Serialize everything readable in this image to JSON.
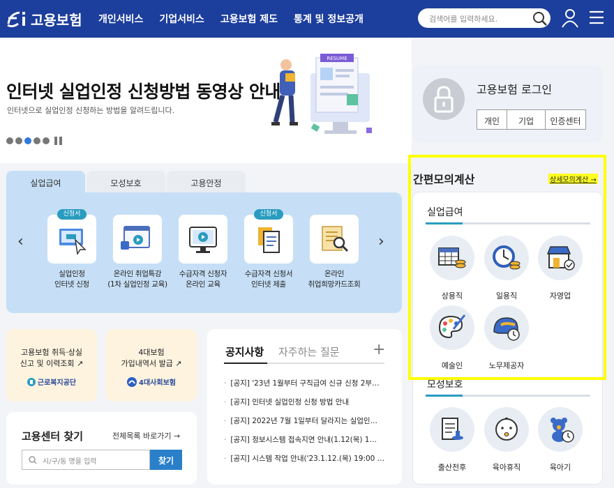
{
  "header": {
    "logo": "고용보험",
    "nav": [
      "개인서비스",
      "기업서비스",
      "고용보험 제도",
      "통계 및 정보공개"
    ],
    "search_placeholder": "검색어를 입력하세요."
  },
  "banner": {
    "title": "인터넷 실업인정 신청방법 동영상 안내",
    "subtitle": "인터넷으로 실업인정 신청하는 방법을 알려드립니다.",
    "slide_count": 5,
    "active_slide": 3,
    "illustration_text": "RESUME"
  },
  "login": {
    "title": "고용보험 로그인",
    "buttons": [
      "개인",
      "기업",
      "인증센터"
    ]
  },
  "tabs": [
    {
      "label": "실업급여"
    },
    {
      "label": "모성보호"
    },
    {
      "label": "고용안정"
    }
  ],
  "services": [
    {
      "badge": "신청서",
      "line1": "실업인정",
      "line2": "인터넷 신청"
    },
    {
      "badge": "",
      "line1": "온라인 취업특강",
      "line2": "(1차 실업인정 교육)"
    },
    {
      "badge": "",
      "line1": "수급자격 신청자",
      "line2": "온라인 교육"
    },
    {
      "badge": "신청서",
      "line1": "수급자격 신청서",
      "line2": "인터넷 제출"
    },
    {
      "badge": "",
      "line1": "온라인",
      "line2": "취업희망카드조회"
    }
  ],
  "quick_links": [
    {
      "line1": "고용보험 취득·상실",
      "line2": "신고 및 이력조회 ↗",
      "org": "근로복지공단"
    },
    {
      "line1": "4대보험",
      "line2": "가입내역서 발급 ↗",
      "org": "4대사회보험"
    }
  ],
  "center_find": {
    "title": "고용센터 찾기",
    "more": "전체목록 바로가기 →",
    "placeholder": "시/구/동 명을 입력",
    "button": "찾기"
  },
  "notice": {
    "tab_active": "공지사항",
    "tab_inactive": "자주하는 질문",
    "plus": "+",
    "items": [
      "[공지] '23년 1월부터 구직급여 신규 신청 2부…",
      "[공지] 인터넷 실업인정 신청 방법 안내",
      "[공지] 2022년 7월 1일부터 달라지는 실업인…",
      "[공지] 정보시스템 접속지연 안내(1.12(목) 1…",
      "[공지] 시스템 작업 안내('23.1.12.(목) 19:00 …"
    ]
  },
  "calc": {
    "title": "간편모의계산",
    "more": "상세모의계산 →",
    "sections": [
      {
        "title": "실업급여",
        "items": [
          "상용직",
          "일용직",
          "자영업",
          "예술인",
          "노무제공자"
        ]
      },
      {
        "title": "모성보호",
        "items": [
          "출산전후",
          "육아휴직",
          "육아기"
        ]
      }
    ]
  }
}
